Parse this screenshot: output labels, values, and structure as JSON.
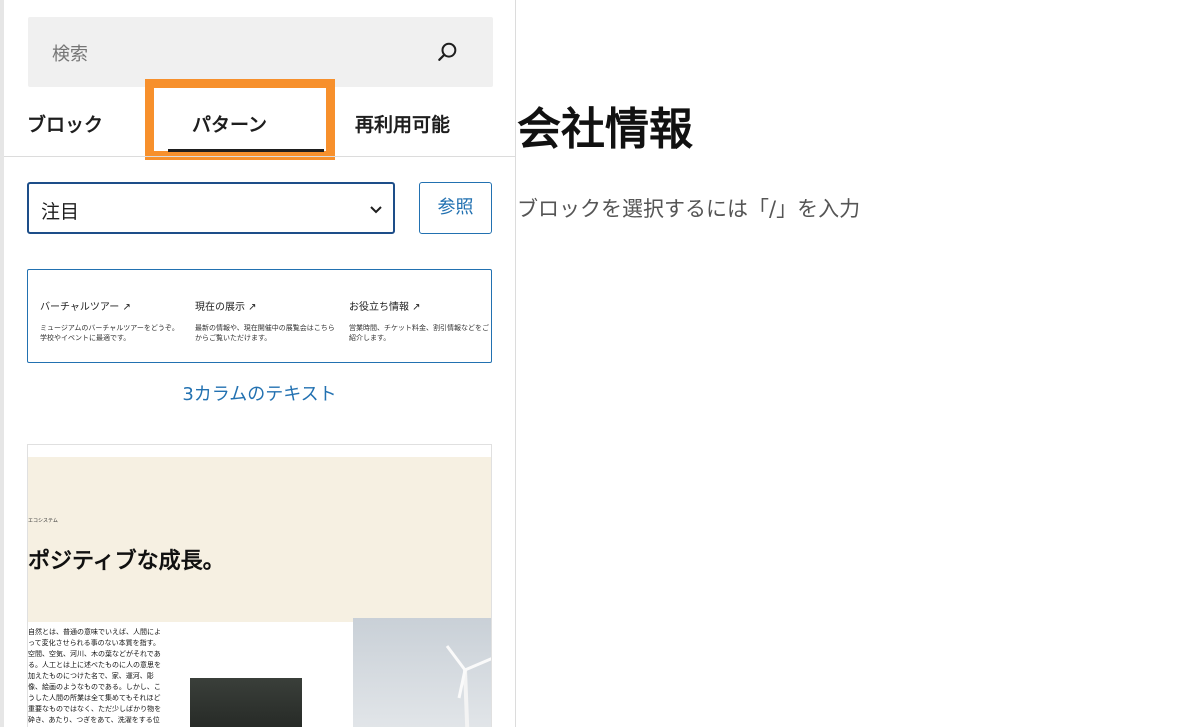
{
  "inserter": {
    "search": {
      "placeholder": "検索"
    },
    "tabs": [
      {
        "label": "ブロック"
      },
      {
        "label": "パターン"
      },
      {
        "label": "再利用可能"
      }
    ],
    "category_select": {
      "value": "注目"
    },
    "browse_button": {
      "label": "参照"
    },
    "patterns": [
      {
        "caption": "3カラムのテキスト",
        "columns": [
          {
            "title": "バーチャルツアー ↗",
            "body": "ミュージアムのバーチャルツアーをどうぞ。学校やイベントに最適です。"
          },
          {
            "title": "現在の展示 ↗",
            "body": "最新の情報や、現在開催中の展覧会はこちらからご覧いただけます。"
          },
          {
            "title": "お役立ち情報 ↗",
            "body": "営業時間、チケット料金、割引情報などをご紹介します。"
          }
        ]
      },
      {
        "eyebrow": "エコシステム",
        "heading": "ポジティブな成長。",
        "body": "自然とは、普通の意味でいえば、人間によって変化させられる事のない本質を指す。空間、空気、河川、木の葉などがそれである。人工とは上に述べたものに人の意思を加えたものにつけた名で、家、運河、彫像、絵画のようなものである。しかし、こうした人間の所業は全て集めてもそれほど重要なものではなく、ただ少しばかり物を砕き、あたり、つぎをあて、洗濯をする位なものであるから、それが、世界が人の心に与えるような、偉大な感銘が与える結果に、変化を与えることは無い。"
      }
    ]
  },
  "editor": {
    "title": "会社情報",
    "placeholder": "ブロックを選択するには「/」を入力"
  }
}
